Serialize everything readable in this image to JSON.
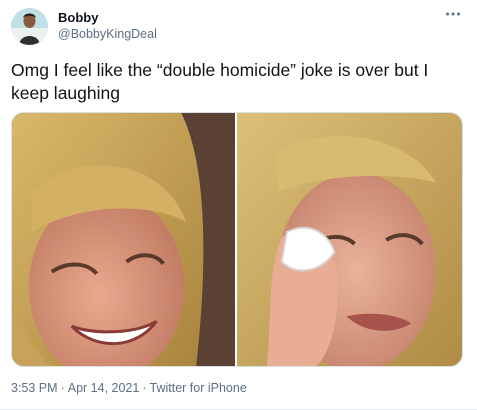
{
  "tweet": {
    "display_name": "Bobby",
    "handle": "@BobbyKingDeal",
    "text": "Omg I feel like the “double homicide” joke is over but I keep laughing",
    "more_icon": "more-dots-icon",
    "time": "3:53 PM",
    "date": "Apr 14, 2021",
    "source": "Twitter for iPhone",
    "separator": "·"
  },
  "media": {
    "images": [
      {
        "name": "crying-laughing-woman-photo"
      },
      {
        "name": "crying-woman-wiping-tears-photo"
      }
    ]
  },
  "colors": {
    "text": "#0f1419",
    "secondary": "#5b7083",
    "border": "#d9e1e6"
  }
}
